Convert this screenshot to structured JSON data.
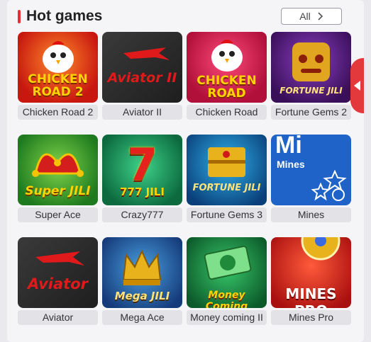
{
  "section": {
    "title": "Hot games",
    "all_label": "All"
  },
  "games": [
    {
      "name": "Chicken Road 2",
      "art": "CHICKEN ROAD 2"
    },
    {
      "name": "Aviator II",
      "art": "Aviator II"
    },
    {
      "name": "Chicken Road",
      "art": "CHICKEN ROAD"
    },
    {
      "name": "Fortune Gems 2",
      "art": "FORTUNE JILI"
    },
    {
      "name": "Super Ace",
      "art": "Super JILI"
    },
    {
      "name": "Crazy777",
      "art": "777 JILI"
    },
    {
      "name": "Fortune Gems 3",
      "art": "FORTUNE JILI"
    },
    {
      "name": "Mines",
      "art": "Mi",
      "art_sub": "Mines"
    },
    {
      "name": "Aviator",
      "art": "Aviator"
    },
    {
      "name": "Mega Ace",
      "art": "Mega JILI"
    },
    {
      "name": "Money coming II",
      "art": "Money Coming"
    },
    {
      "name": "Mines Pro",
      "art": "MINES PRO"
    }
  ],
  "colors": {
    "accent": "#e63030",
    "side_tab": "#e4393c"
  }
}
